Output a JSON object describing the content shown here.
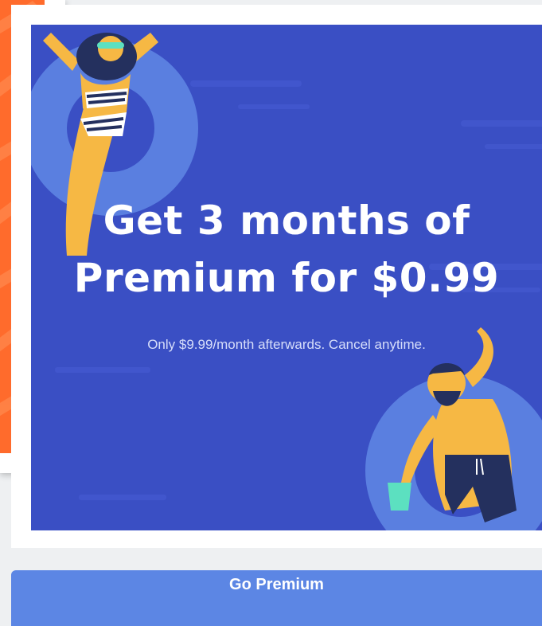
{
  "promo": {
    "headline_line1": "Get 3 months of",
    "headline_line2": "Premium for $0.99",
    "subline": "Only $9.99/month afterwards. Cancel anytime."
  },
  "cta": {
    "label": "Go Premium"
  },
  "colors": {
    "promo_background": "#3a4fc4",
    "button_background": "#5c86e4",
    "side_card_art": "#ff6b2c",
    "float_ring": "#5a7fe0"
  },
  "icons": {
    "woman_illustration": "woman-on-float-illustration",
    "man_illustration": "man-on-float-illustration"
  }
}
